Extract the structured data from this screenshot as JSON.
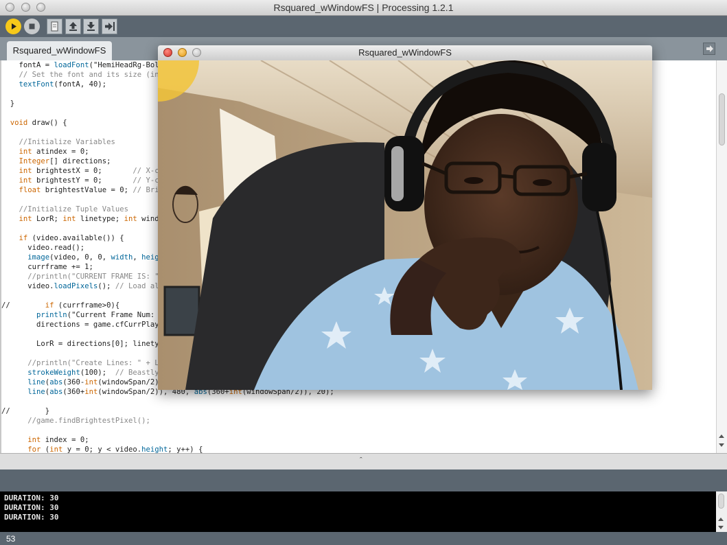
{
  "window": {
    "title": "Rsquared_wWindowFS | Processing 1.2.1"
  },
  "toolbar": {
    "buttons": [
      {
        "name": "run",
        "icon": "play-icon"
      },
      {
        "name": "stop",
        "icon": "stop-icon"
      },
      {
        "name": "new",
        "icon": "new-file-icon"
      },
      {
        "name": "open",
        "icon": "open-upload-icon"
      },
      {
        "name": "save",
        "icon": "save-download-icon"
      },
      {
        "name": "export",
        "icon": "export-icon"
      }
    ]
  },
  "tabs": {
    "active": "Rsquared_wWindowFS"
  },
  "editor": {
    "lines": [
      "    fontA = loadFont(\"HemiHeadRg-Bold-48.vlw\");",
      "    // Set the font and its size (in units of pixels)",
      "    textFont(fontA, 40);",
      "",
      "  }",
      "",
      "  void draw() {",
      "",
      "    //Initialize Variables",
      "    int atindex = 0;",
      "    Integer[] directions;",
      "    int brightestX = 0;       // X-coordinate of the brightest video pixel",
      "    int brightestY = 0;       // Y-coordinate of the brightest video pixel",
      "    float brightestValue = 0; // Brightness of the brightest video pixel",
      "",
      "    //Initialize Tuple Values",
      "    int LorR; int linetype; int windowSpan;",
      "",
      "    if (video.available()) {",
      "      video.read();",
      "      image(video, 0, 0, width, height);",
      "      currframe += 1;",
      "      //println(\"CURRENT FRAME IS: \" + currframe);",
      "      video.loadPixels(); // Load all of the video's pixels",
      "",
      "//        if (currframe>0){",
      "        println(\"Current Frame Num: \" + currframe);",
      "        directions = game.cfCurrPlaying(currframe);",
      "",
      "        LorR = directions[0]; linetype = directions[1];",
      "",
      "      //println(\"Create Lines: \" + LorR);",
      "      strokeWeight(100);  // Beastly",
      "      line(abs(360-int(windowSpan/2)), 480, abs(360-int(windowSpan/2)), 20);",
      "      line(abs(360+int(windowSpan/2)), 480, abs(360+int(windowSpan/2)), 20);",
      "",
      "//        }",
      "      //game.findBrightestPixel();",
      "",
      "      int index = 0;",
      "      for (int y = 0; y < video.height; y++) {"
    ]
  },
  "console": {
    "lines": [
      "DURATION: 30",
      "DURATION: 30",
      "DURATION: 30"
    ]
  },
  "footer": {
    "line_number": "53"
  },
  "sketch_window": {
    "title": "Rsquared_wWindowFS"
  },
  "colors": {
    "toolbar_bg": "#5b6670",
    "run_button": "#f6c91a",
    "keyword": "#cc6600",
    "function": "#006699",
    "comment": "#888888",
    "close_red": "#e0443a",
    "minimize_yellow": "#f0b22c"
  }
}
